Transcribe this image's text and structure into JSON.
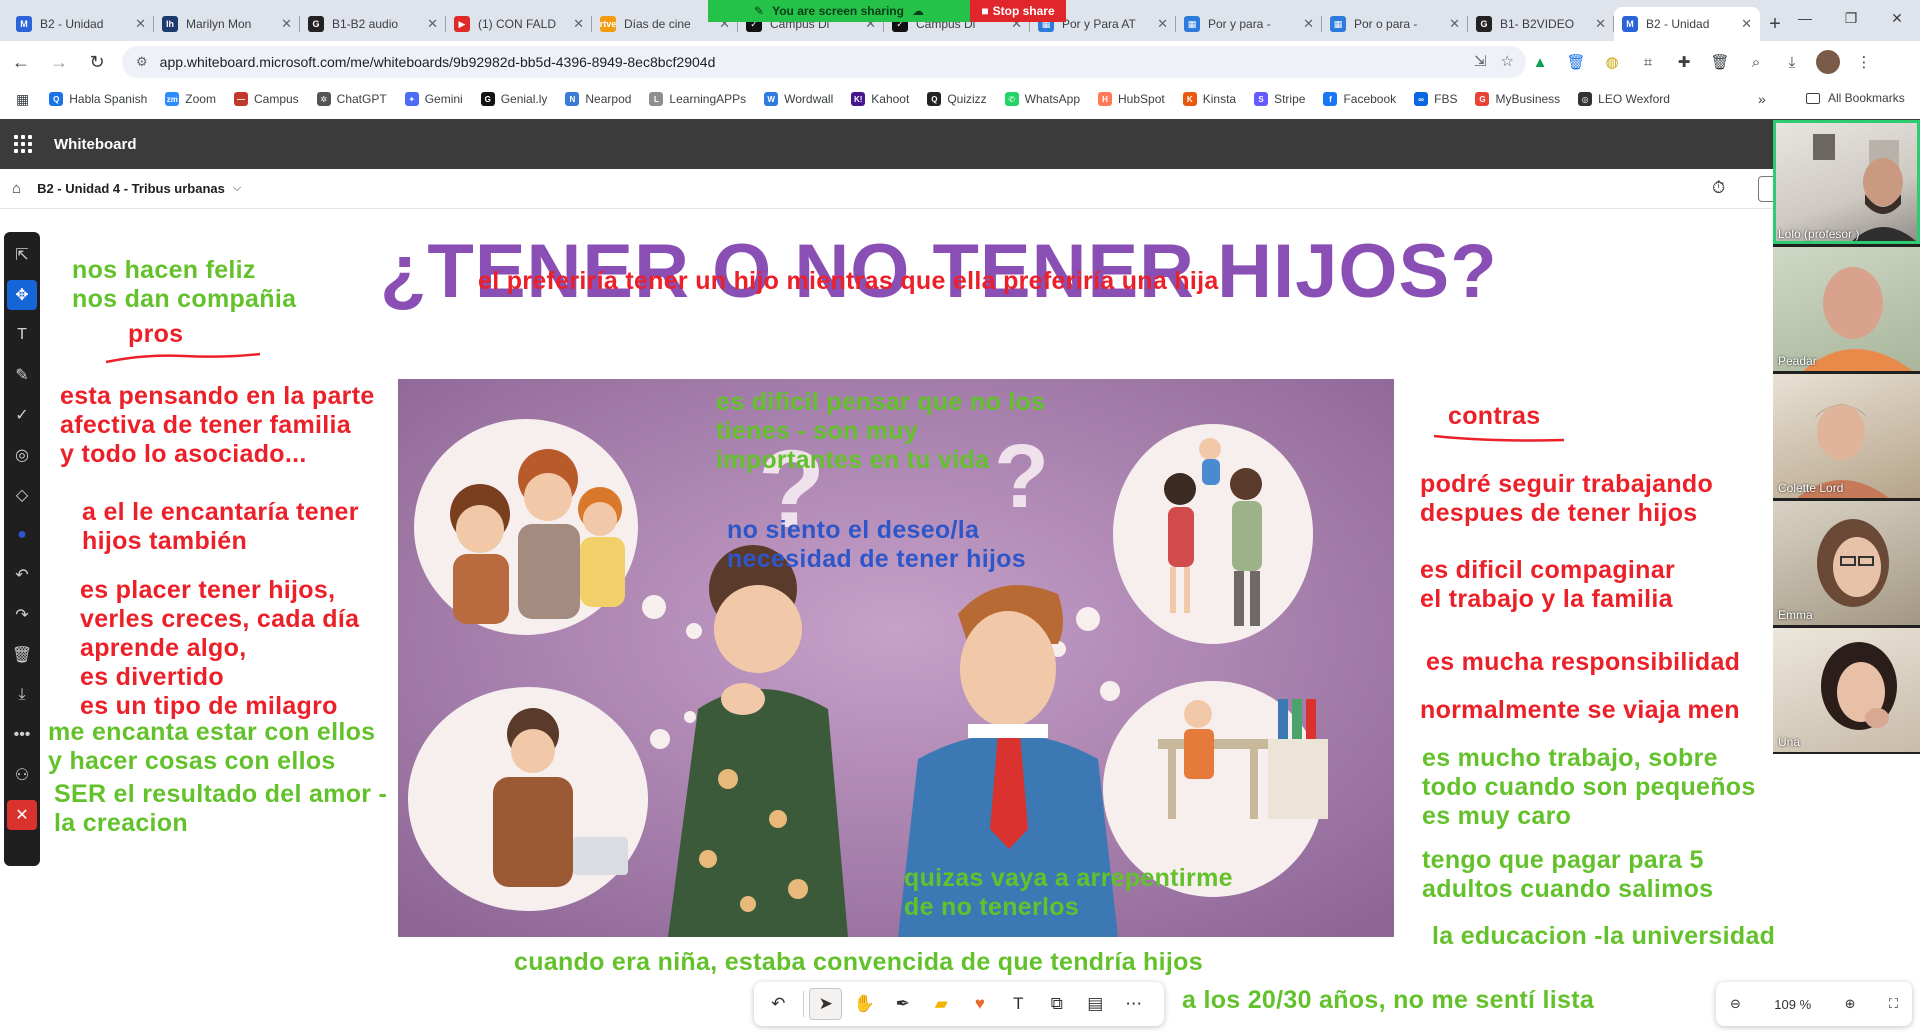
{
  "browser": {
    "tabs": [
      {
        "title": "B2 - Unidad",
        "color": "#2b63d9",
        "glyph": "M",
        "active": false
      },
      {
        "title": "Marilyn Mon",
        "color": "#1b3b6f",
        "glyph": "lh",
        "active": false
      },
      {
        "title": "B1-B2 audio",
        "color": "#222222",
        "glyph": "G",
        "active": false
      },
      {
        "title": "(1) CON FALD",
        "color": "#e02a2a",
        "glyph": "▶",
        "active": false
      },
      {
        "title": "Días de cine",
        "color": "#f39c12",
        "glyph": "rtve",
        "active": false
      },
      {
        "title": "Campus Di",
        "color": "#111111",
        "glyph": "✓",
        "active": false
      },
      {
        "title": "Campus Di",
        "color": "#111111",
        "glyph": "✓",
        "active": false
      },
      {
        "title": "Por y Para AT",
        "color": "#2d7bdc",
        "glyph": "▦",
        "active": false
      },
      {
        "title": "Por y para -",
        "color": "#2d7bdc",
        "glyph": "▦",
        "active": false
      },
      {
        "title": "Por o para -",
        "color": "#2d7bdc",
        "glyph": "▦",
        "active": false
      },
      {
        "title": "B1- B2VIDEO",
        "color": "#222222",
        "glyph": "G",
        "active": false
      },
      {
        "title": "B2 - Unidad",
        "color": "#2b63d9",
        "glyph": "M",
        "active": true
      }
    ],
    "screen_share": {
      "status": "You are screen sharing",
      "stop_label": "Stop share"
    },
    "url": "app.whiteboard.microsoft.com/me/whiteboards/9b92982d-bb5d-4396-8949-8ec8bcf2904d",
    "bookmarks": [
      {
        "label": "Habla Spanish",
        "color": "#1a73e8",
        "glyph": "Q"
      },
      {
        "label": "Zoom",
        "color": "#2d8cff",
        "glyph": "zm"
      },
      {
        "label": "Campus",
        "color": "#c0392b",
        "glyph": "—"
      },
      {
        "label": "ChatGPT",
        "color": "#555555",
        "glyph": "✲"
      },
      {
        "label": "Gemini",
        "color": "#4a6cf7",
        "glyph": "✦"
      },
      {
        "label": "Genial.ly",
        "color": "#111111",
        "glyph": "G"
      },
      {
        "label": "Nearpod",
        "color": "#3a7bd5",
        "glyph": "N"
      },
      {
        "label": "LearningAPPs",
        "color": "#8e8e8e",
        "glyph": "L"
      },
      {
        "label": "Wordwall",
        "color": "#2d7bdc",
        "glyph": "W"
      },
      {
        "label": "Kahoot",
        "color": "#46178f",
        "glyph": "K!"
      },
      {
        "label": "Quizizz",
        "color": "#222222",
        "glyph": "Q"
      },
      {
        "label": "WhatsApp",
        "color": "#25d366",
        "glyph": "✆"
      },
      {
        "label": "HubSpot",
        "color": "#ff7a59",
        "glyph": "H"
      },
      {
        "label": "Kinsta",
        "color": "#e8590c",
        "glyph": "K"
      },
      {
        "label": "Stripe",
        "color": "#635bff",
        "glyph": "S"
      },
      {
        "label": "Facebook",
        "color": "#1877f2",
        "glyph": "f"
      },
      {
        "label": "FBS",
        "color": "#0668e1",
        "glyph": "∞"
      },
      {
        "label": "MyBusiness",
        "color": "#ea4335",
        "glyph": "G"
      },
      {
        "label": "LEO Wexford",
        "color": "#333333",
        "glyph": "◎"
      }
    ],
    "all_bookmarks_label": "All Bookmarks"
  },
  "app": {
    "name": "Whiteboard",
    "board_name": "B2 - Unidad 4 - Tribus urbanas"
  },
  "canvas": {
    "title": "¿TENER O NO TENER HIJOS?",
    "subtitle": "el preferiría tener un hijo mientras que ella preferiría una hija",
    "pros_label": "pros",
    "contras_label": "contras",
    "notes": [
      {
        "id": "n1",
        "color": "green",
        "text": "nos hacen feliz\nnos dan compañia"
      },
      {
        "id": "n2",
        "color": "red",
        "text": "esta pensando en la parte\nafectiva de tener familia\ny todo lo asociado..."
      },
      {
        "id": "n3",
        "color": "red",
        "text": "a el le encantaría tener\nhijos también"
      },
      {
        "id": "n4",
        "color": "red",
        "text": "es placer tener hijos,\nverles creces, cada día\naprende algo,\nes divertido\nes un tipo de milagro"
      },
      {
        "id": "n5",
        "color": "green",
        "text": "me encanta estar con ellos\ny hacer cosas con ellos"
      },
      {
        "id": "n6",
        "color": "green",
        "text": "SER el resultado del amor -\nla creacion"
      },
      {
        "id": "n7",
        "color": "green",
        "text": "es dificil pensar que no los\ntienes - son muy\nimportantes en tu vida"
      },
      {
        "id": "n8",
        "color": "blue",
        "text": "no siento el deseo/la\nnecesidad de tener hijos"
      },
      {
        "id": "n9",
        "color": "green",
        "text": "quizas vaya a arrepentirme\nde no tenerlos"
      },
      {
        "id": "n10",
        "color": "green",
        "text": "cuando era niña, estaba convencida de que tendría hijos"
      },
      {
        "id": "n11",
        "color": "red",
        "text": "podré seguir trabajando\ndespues de tener hijos"
      },
      {
        "id": "n12",
        "color": "red",
        "text": "es dificil compaginar\nel trabajo y la familia"
      },
      {
        "id": "n13",
        "color": "red",
        "text": "es mucha responsibilidad"
      },
      {
        "id": "n14",
        "color": "red",
        "text": "normalmente se viaja men"
      },
      {
        "id": "n15",
        "color": "green",
        "text": "es mucho trabajo, sobre\ntodo cuando son pequeños\nes muy caro"
      },
      {
        "id": "n16",
        "color": "green",
        "text": "tengo que pagar para 5\nadultos cuando salimos"
      },
      {
        "id": "n17",
        "color": "green",
        "text": "la educacion -la universidad"
      },
      {
        "id": "n18",
        "color": "green",
        "text": "a los 20/30 años, no me sentí lista"
      }
    ]
  },
  "zoom": {
    "level": "109 %"
  },
  "colors": {
    "title": "#8a4fb5",
    "red": "#ec2028",
    "green": "#63c22b",
    "blue": "#2e56c9",
    "app_header": "#3b3b3b",
    "accent": "#1565d8"
  },
  "participants": [
    {
      "name": "Lolo (profesor )",
      "speaking": true
    },
    {
      "name": "Peadar",
      "speaking": false
    },
    {
      "name": "Colette Lord",
      "speaking": false
    },
    {
      "name": "Emma",
      "speaking": false
    },
    {
      "name": "Una",
      "speaking": false
    }
  ]
}
